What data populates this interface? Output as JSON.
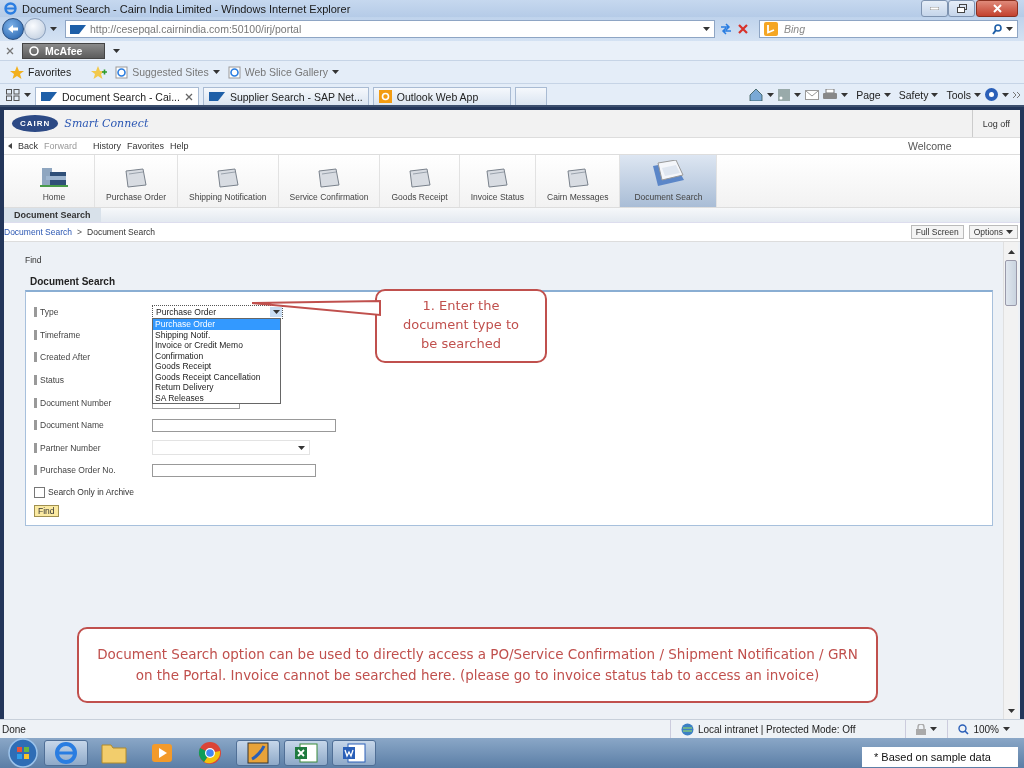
{
  "window": {
    "title": "Document Search - Cairn India Limited - Windows Internet Explorer"
  },
  "address_bar": {
    "url": "http://cesepqal.cairnindia.com:50100/irj/portal",
    "search_placeholder": "Bing"
  },
  "addon_bar": {
    "addon": "McAfee"
  },
  "favorites_bar": {
    "label": "Favorites",
    "items": [
      "Suggested Sites",
      "Web Slice Gallery"
    ]
  },
  "tabs": [
    {
      "label": "Document Search - Cai...",
      "selected": true
    },
    {
      "label": "Supplier Search - SAP Net...",
      "selected": false
    },
    {
      "label": "Outlook Web App",
      "selected": false
    }
  ],
  "command_bar": [
    "Page",
    "Safety",
    "Tools"
  ],
  "portal": {
    "logo": "CAIRN",
    "brand": "Smart Connect",
    "logoff": "Log off",
    "welcome": "Welcome",
    "history_nav": [
      {
        "label": "Back",
        "disabled": false
      },
      {
        "label": "Forward",
        "disabled": true
      },
      {
        "label": "History",
        "disabled": false
      },
      {
        "label": "Favorites",
        "disabled": false
      },
      {
        "label": "Help",
        "disabled": false
      }
    ],
    "top_nav": [
      {
        "label": "Home",
        "kind": "home",
        "selected": false
      },
      {
        "label": "Purchase Order",
        "kind": "folder",
        "selected": false
      },
      {
        "label": "Shipping Notification",
        "kind": "folder",
        "selected": false
      },
      {
        "label": "Service Confirmation",
        "kind": "folder",
        "selected": false
      },
      {
        "label": "Goods Receipt",
        "kind": "folder",
        "selected": false
      },
      {
        "label": "Invoice Status",
        "kind": "folder",
        "selected": false
      },
      {
        "label": "Cairn Messages",
        "kind": "folder",
        "selected": false
      },
      {
        "label": "Document Search",
        "kind": "documents",
        "selected": true
      }
    ],
    "detail_nav": "Document Search",
    "breadcrumb": [
      "Document Search",
      ">",
      "Document Search"
    ],
    "page_buttons": [
      {
        "label": "Full Screen",
        "kind": "plain"
      },
      {
        "label": "Options",
        "kind": "menu"
      }
    ]
  },
  "find": {
    "caption": "Find",
    "title": "Document Search",
    "fields": [
      {
        "label": "Type",
        "kind": "select",
        "value": "Purchase Order"
      },
      {
        "label": "Timeframe",
        "kind": "covered"
      },
      {
        "label": "Created After",
        "kind": "covered"
      },
      {
        "label": "Status",
        "kind": "covered"
      },
      {
        "label": "Document Number",
        "kind": "input"
      },
      {
        "label": "Document Name",
        "kind": "input"
      },
      {
        "label": "Partner Number",
        "kind": "select"
      },
      {
        "label": "Purchase Order No.",
        "kind": "input"
      }
    ],
    "dropdown": {
      "options": [
        {
          "label": "Purchase Order",
          "selected": true
        },
        {
          "label": "Shipping Notif.",
          "selected": false
        },
        {
          "label": "Invoice or Credit Memo",
          "selected": false
        },
        {
          "label": "Confirmation",
          "selected": false
        },
        {
          "label": "Goods Receipt",
          "selected": false
        },
        {
          "label": "Goods Receipt Cancellation",
          "selected": false
        },
        {
          "label": "Return Delivery",
          "selected": false
        },
        {
          "label": "SA Releases",
          "selected": false
        }
      ]
    },
    "archive": {
      "label": "Search Only in Archive",
      "checked": false
    },
    "button": "Find"
  },
  "callouts": [
    {
      "kind": "pointer",
      "text": "1. Enter the document type to be searched"
    },
    {
      "kind": "note",
      "text": "Document Search option can be used to directly access a PO/Service Confirmation / Shipment Notification / GRN on the Portal. Invoice cannot be searched here. (please go to invoice status tab to access an invoice)"
    }
  ],
  "status_bar": {
    "status": "Done",
    "zone": "Local intranet | Protected Mode: Off",
    "zoom": "100%"
  },
  "footnote": "* Based on sample data"
}
